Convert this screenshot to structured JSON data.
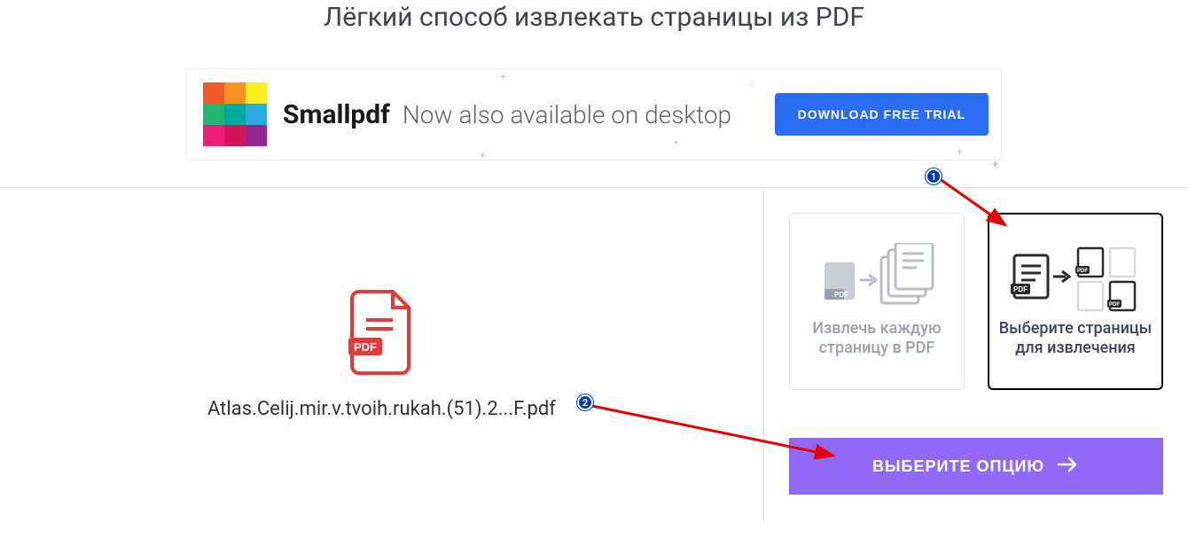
{
  "page": {
    "title": "Лёгкий способ извлекать страницы из PDF"
  },
  "banner": {
    "brand": "Smallpdf",
    "slogan": "Now also available on desktop",
    "download_label": "DOWNLOAD FREE TRIAL",
    "logo_colors": [
      "#f15a24",
      "#f7931e",
      "#fcee21",
      "#22b573",
      "#00a99d",
      "#29abe2",
      "#ed1e79",
      "#d4145a",
      "#93278f"
    ]
  },
  "file": {
    "name": "Atlas.Celij.mir.v.tvoih.rukah.(51).2...F.pdf"
  },
  "options": {
    "extract_all_label": "Извлечь каждую страницу в PDF",
    "select_pages_label": "Выберите страницы для извлечения"
  },
  "action": {
    "choose_label": "ВЫБЕРИТЕ ОПЦИЮ"
  },
  "annotations": {
    "marker1": "1",
    "marker2": "2"
  }
}
